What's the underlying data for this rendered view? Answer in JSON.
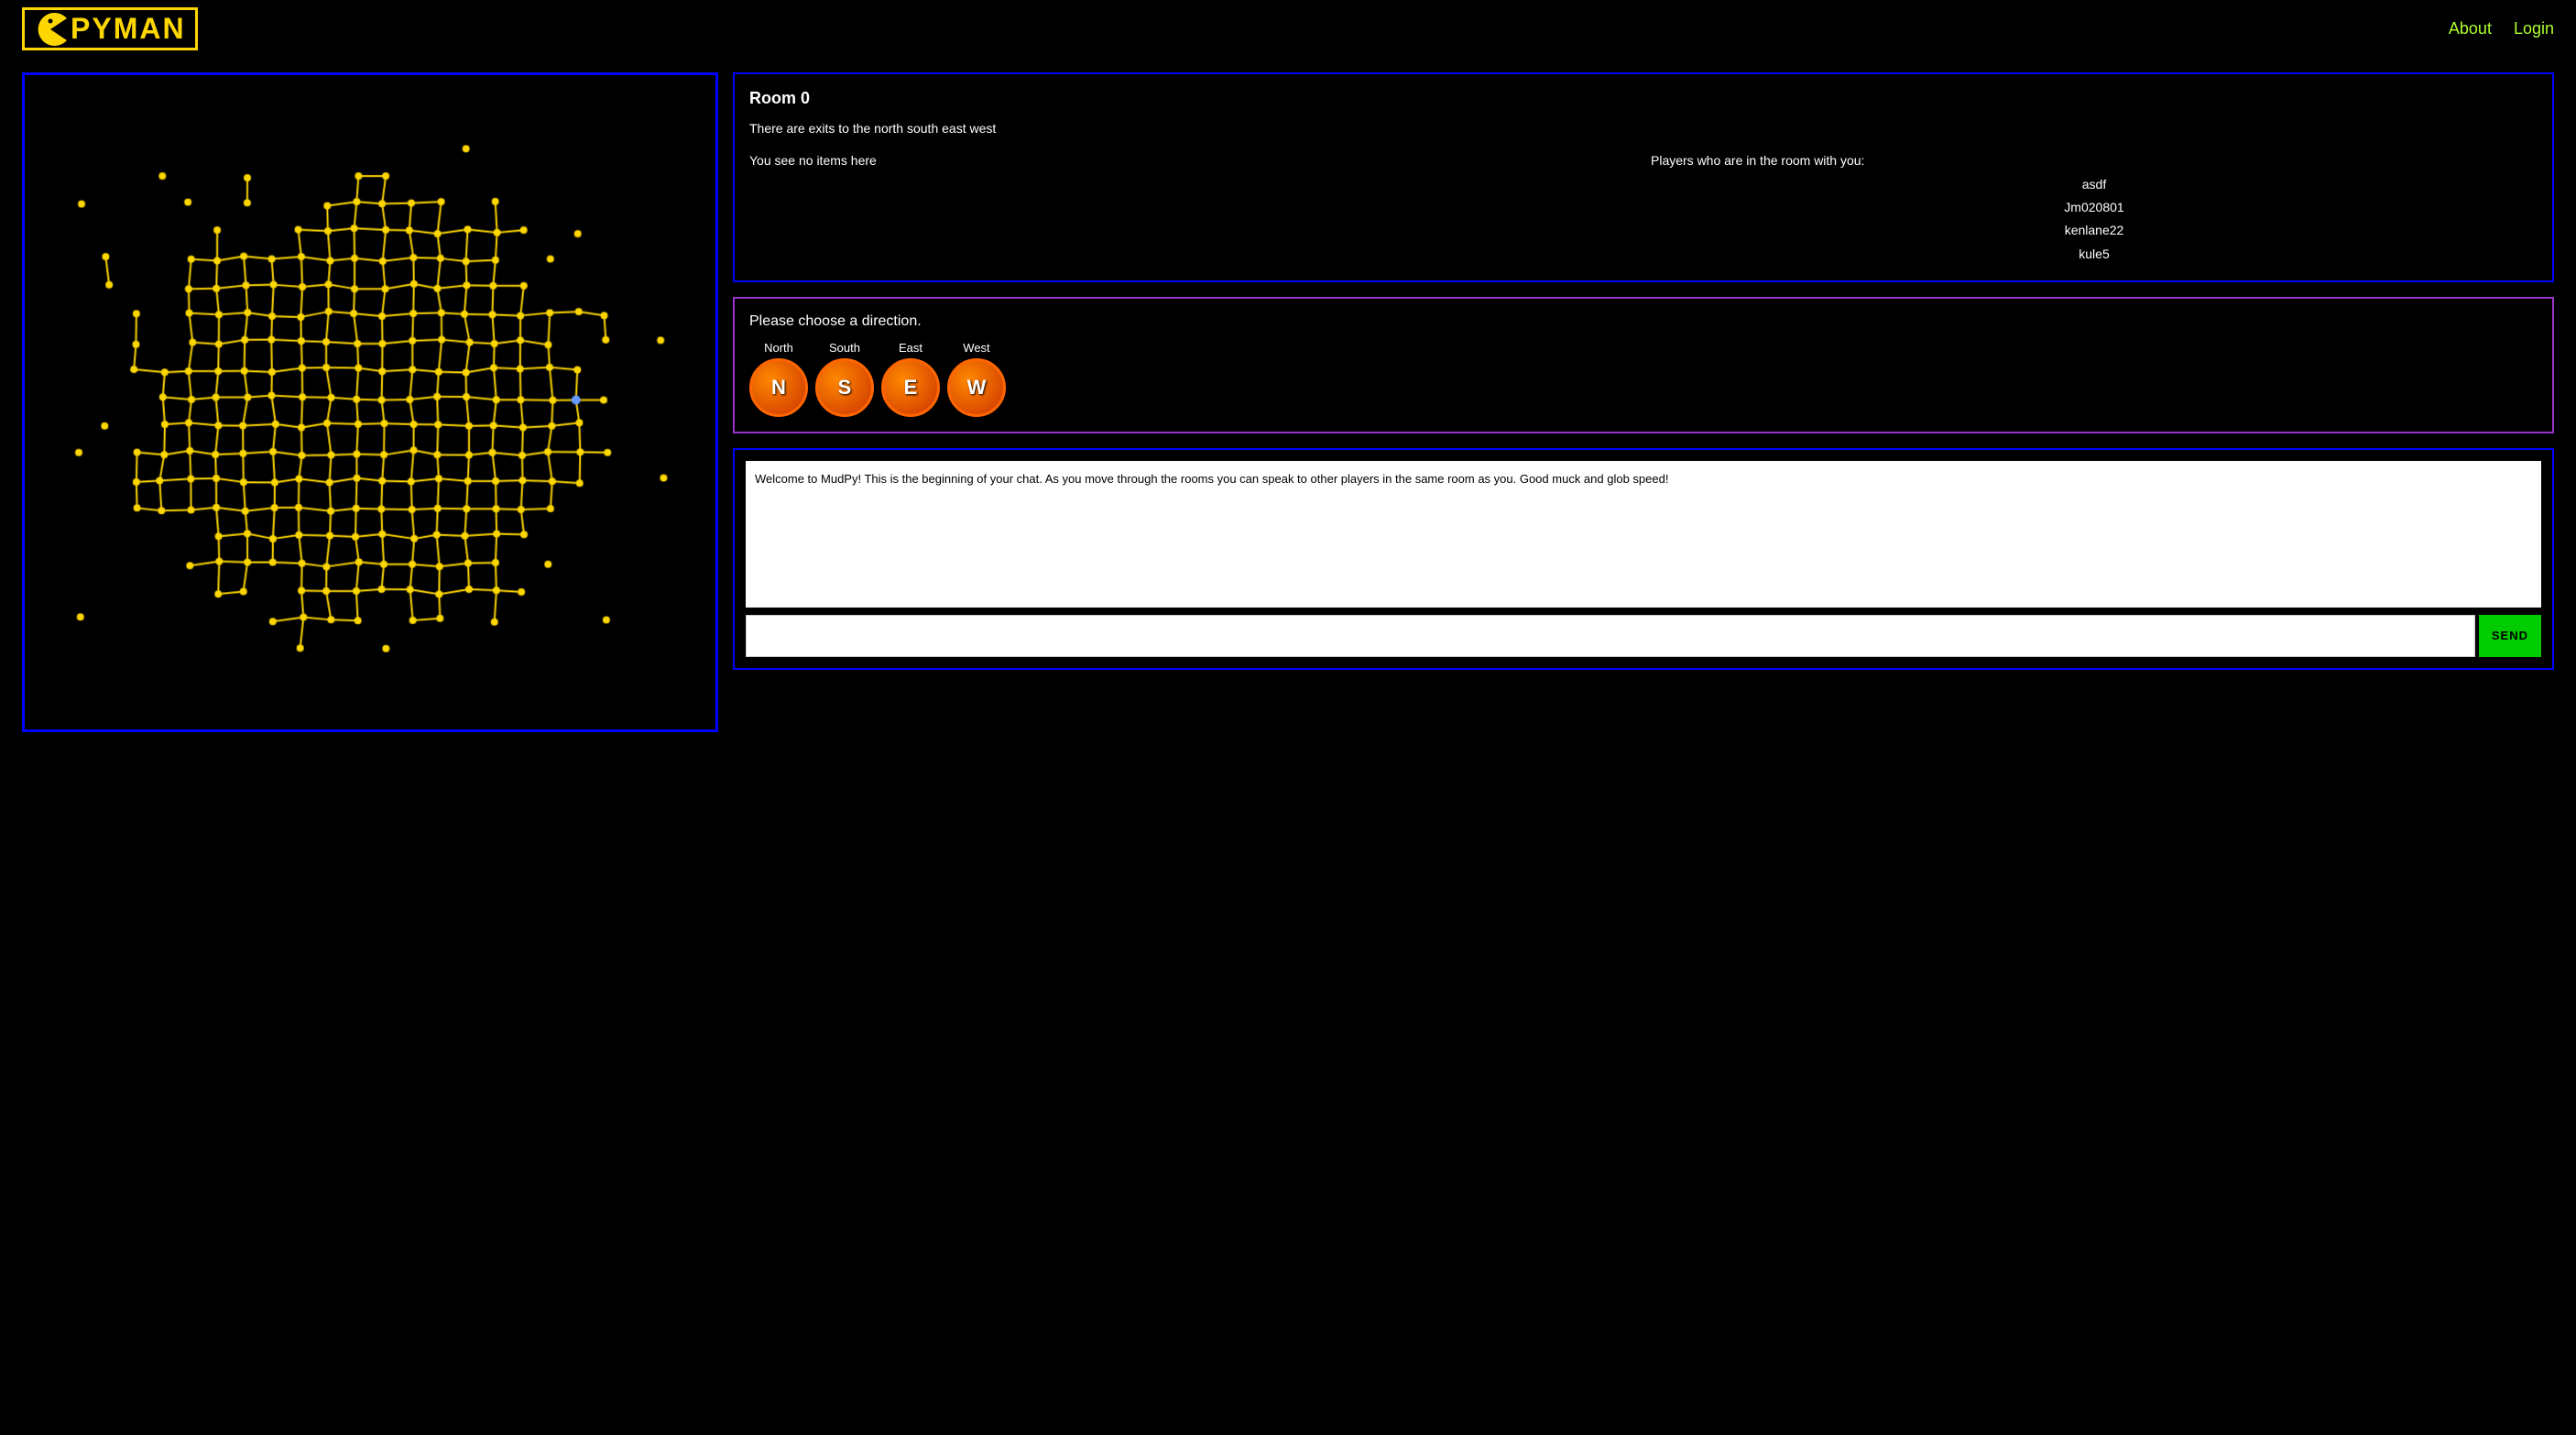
{
  "header": {
    "logo_text": "PYMAN",
    "nav": [
      {
        "label": "About",
        "id": "about"
      },
      {
        "label": "Login",
        "id": "login"
      }
    ]
  },
  "room": {
    "title": "Room 0",
    "exits_text": "There are exits to the north south east west",
    "items_text": "You see no items here",
    "players_header": "Players who are in the room with you:",
    "players": [
      "asdf",
      "Jm020801",
      "kenlane22",
      "kule5"
    ]
  },
  "direction": {
    "label": "Please choose a direction.",
    "buttons": [
      {
        "label": "North",
        "letter": "N",
        "id": "north"
      },
      {
        "label": "South",
        "letter": "S",
        "id": "south"
      },
      {
        "label": "East",
        "letter": "E",
        "id": "east"
      },
      {
        "label": "West",
        "letter": "W",
        "id": "west"
      }
    ]
  },
  "chat": {
    "log_text": "Welcome to MudPy! This is the beginning of your chat. As you move through the rooms you can speak to other players in the same room as you. Good muck and glob speed!",
    "input_placeholder": "",
    "send_label": "SEND"
  },
  "colors": {
    "accent_yellow": "#FFD700",
    "accent_green": "#ADFF2F",
    "map_line": "#FFD700",
    "map_dot": "#FFD700",
    "player_dot": "#6699FF",
    "border_blue": "#0000FF",
    "border_purple": "#9933CC",
    "dir_btn_bg": "#CC3300",
    "dir_btn_border": "#FF6600",
    "send_bg": "#00CC00"
  }
}
